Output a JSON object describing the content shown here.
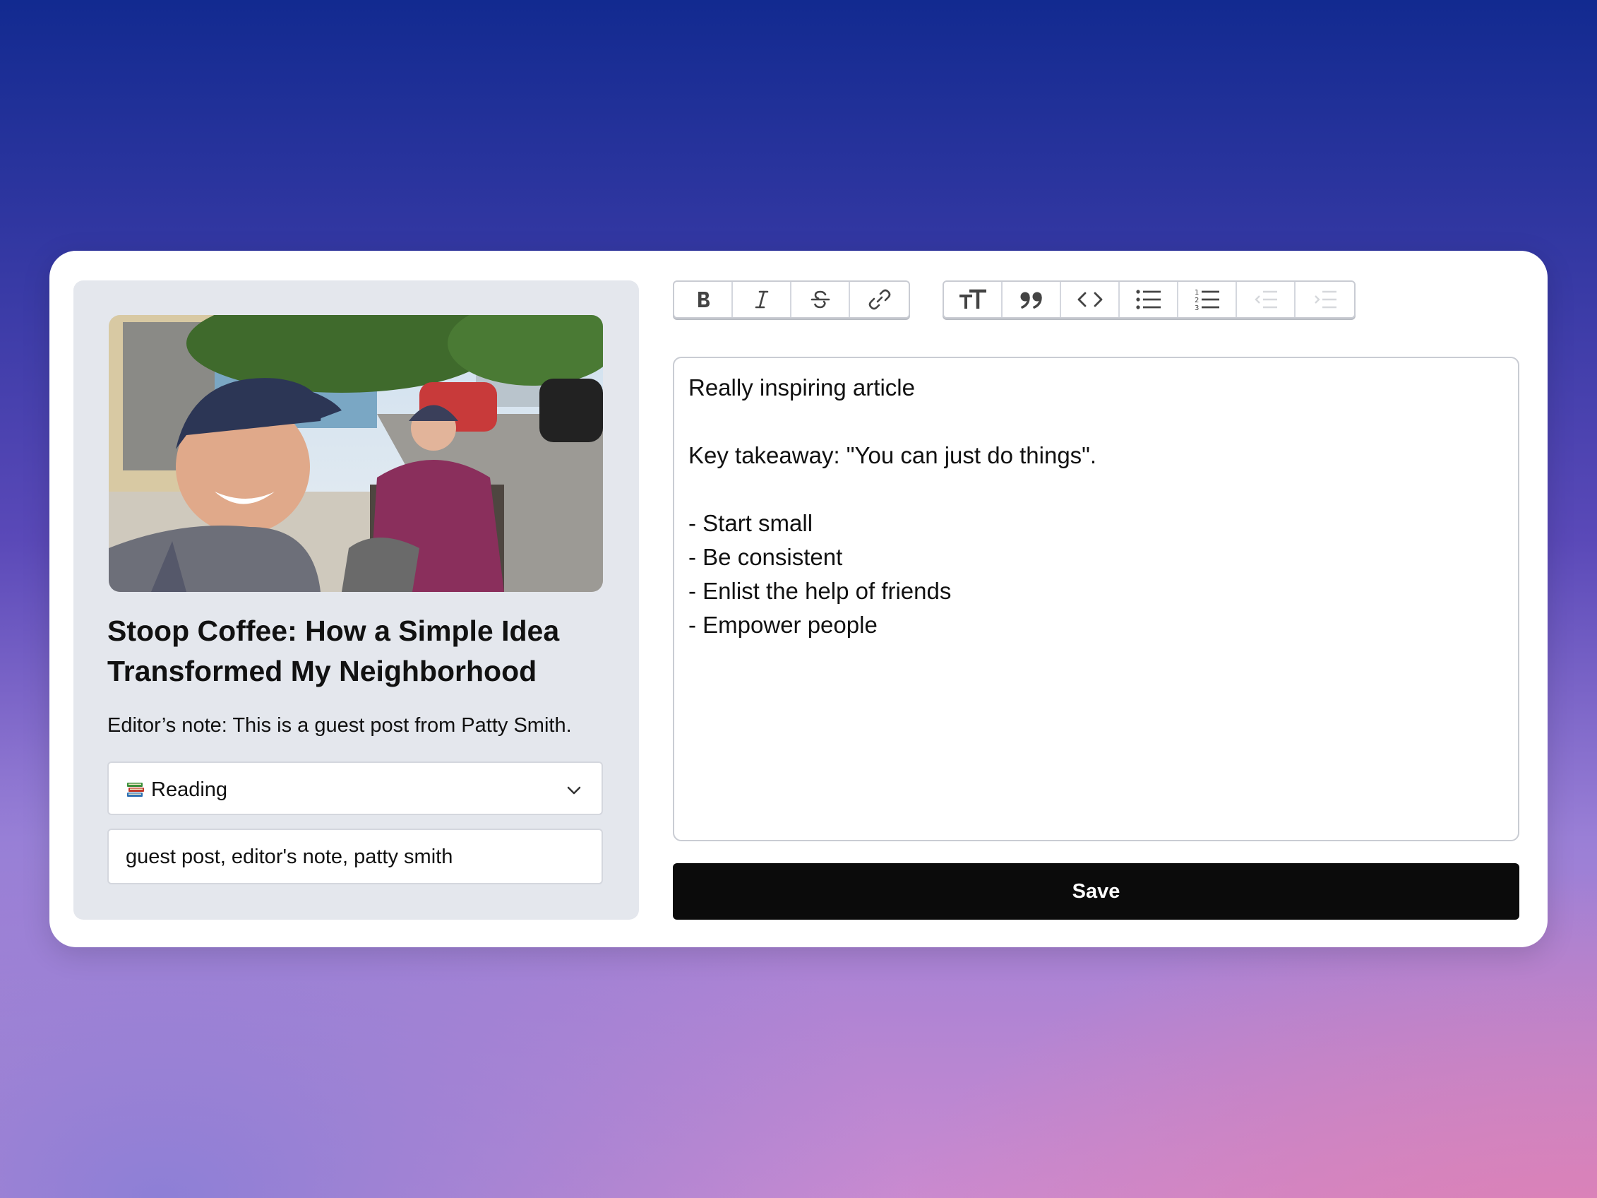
{
  "post": {
    "title": "Stoop Coffee: How a Simple Idea Transformed My Neighborhood",
    "editor_note": "Editor’s note: This is a guest post from Patty Smith.",
    "category": {
      "selected": "Reading",
      "icon": "books-emoji"
    },
    "tags": "guest post, editor's note, patty smith"
  },
  "toolbar": {
    "group1": [
      "bold-icon",
      "italic-icon",
      "strikethrough-icon",
      "link-icon"
    ],
    "group2": [
      "heading-icon",
      "quote-icon",
      "code-icon",
      "bullet-list-icon",
      "numbered-list-icon",
      "outdent-icon",
      "indent-icon"
    ]
  },
  "editor": {
    "lines": [
      "Really inspiring article",
      "",
      "Key takeaway: \"You can just do things\".",
      "",
      "- Start small",
      "- Be consistent",
      "- Enlist the help of friends",
      "- Empower people"
    ]
  },
  "actions": {
    "save_label": "Save"
  },
  "colors": {
    "save_bg": "#0b0b0b",
    "panel_bg": "#e4e7ed",
    "card_bg": "#ffffff"
  }
}
